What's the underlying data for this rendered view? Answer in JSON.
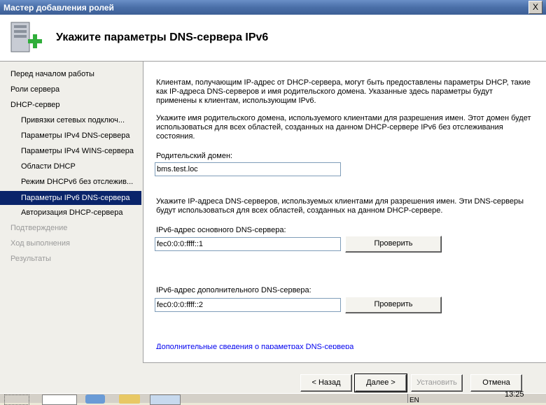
{
  "window": {
    "title": "Мастер добавления ролей",
    "close": "X"
  },
  "header": {
    "title": "Укажите параметры DNS-сервера IPv6"
  },
  "sidebar": {
    "items": [
      {
        "label": "Перед началом работы"
      },
      {
        "label": "Роли сервера"
      },
      {
        "label": "DHCP-сервер"
      },
      {
        "label": "Привязки сетевых подключ..."
      },
      {
        "label": "Параметры IPv4 DNS-сервера"
      },
      {
        "label": "Параметры IPv4 WINS-сервера"
      },
      {
        "label": "Области DHCP"
      },
      {
        "label": "Режим DHCPv6 без отслежив..."
      },
      {
        "label": "Параметры IPv6 DNS-сервера"
      },
      {
        "label": "Авторизация DHCP-сервера"
      },
      {
        "label": "Подтверждение"
      },
      {
        "label": "Ход выполнения"
      },
      {
        "label": "Результаты"
      }
    ]
  },
  "main": {
    "intro": "Клиентам, получающим IP-адрес от DHCP-сервера, могут быть предоставлены параметры DHCP, такие как IP-адреса DNS-серверов и имя родительского домена. Указанные здесь параметры будут применены к клиентам, использующим IPv6.",
    "domain_desc": "Укажите имя родительского домена, используемого клиентами для разрешения имен. Этот домен будет использоваться для всех областей, созданных на данном DHCP-сервере IPv6 без отслеживания состояния.",
    "domain_label": "Родительский домен:",
    "domain_value": "bms.test.loc",
    "dns_desc": "Укажите IP-адреса DNS-серверов, используемых клиентами для разрешения имен. Эти DNS-серверы будут использоваться для всех областей, созданных на данном DHCP-сервере.",
    "primary_label": "IPv6-адрес основного DNS-сервера:",
    "primary_value": "fec0:0:0:ffff::1",
    "secondary_label": "IPv6-адрес дополнительного DNS-сервера:",
    "secondary_value": "fec0:0:0:ffff::2",
    "verify_label": "Проверить",
    "link": "Дополнительные сведения о параметрах DNS-сервера"
  },
  "footer": {
    "back": "< Назад",
    "next": "Далее >",
    "install": "Установить",
    "cancel": "Отмена"
  },
  "taskbar": {
    "lang": "EN",
    "time": "13:25"
  }
}
